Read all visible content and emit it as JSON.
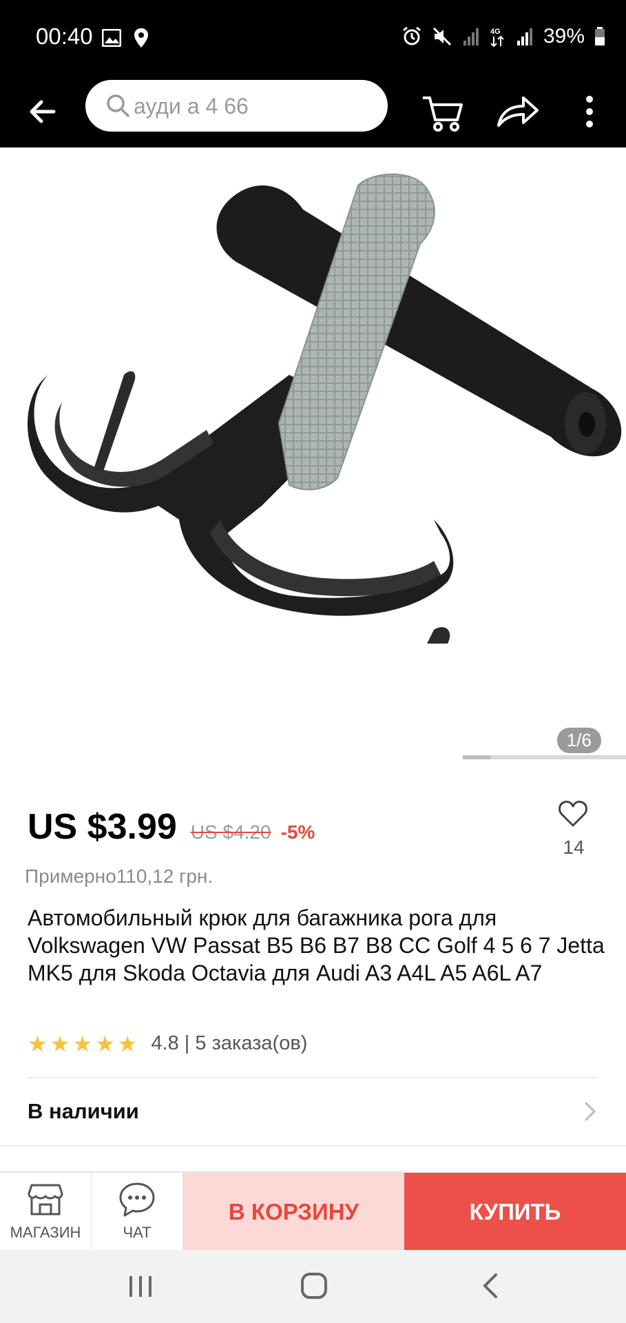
{
  "status_bar": {
    "time": "00:40",
    "battery": "39%"
  },
  "header": {
    "search_placeholder": "ауди а 4 66"
  },
  "gallery": {
    "counter": "1/6",
    "progress": 0.1667
  },
  "product": {
    "price": "US $3.99",
    "old_price": "US $4.20",
    "discount": "-5%",
    "wishlist_count": "14",
    "approx_price": "Примерно110,12 грн.",
    "title": "Автомобильный крюк для багажника рога для Volkswagen VW Passat B5 B6 B7 B8 CC Golf 4 5 6 7 Jetta MK5 для Skoda Octavia для Audi A3 A4L A5 A6L A7",
    "rating": "4.8 | 5 заказа(ов)",
    "rating_stars": 5
  },
  "stock": {
    "label": "В наличии"
  },
  "actions": {
    "store_label": "МАГАЗИН",
    "chat_label": "ЧАТ",
    "cart_label": "В КОРЗИНУ",
    "buy_label": "КУПИТЬ"
  },
  "colors": {
    "accent": "#ec5049",
    "accent_light": "#fcd9d6",
    "star": "#f7c23b"
  }
}
